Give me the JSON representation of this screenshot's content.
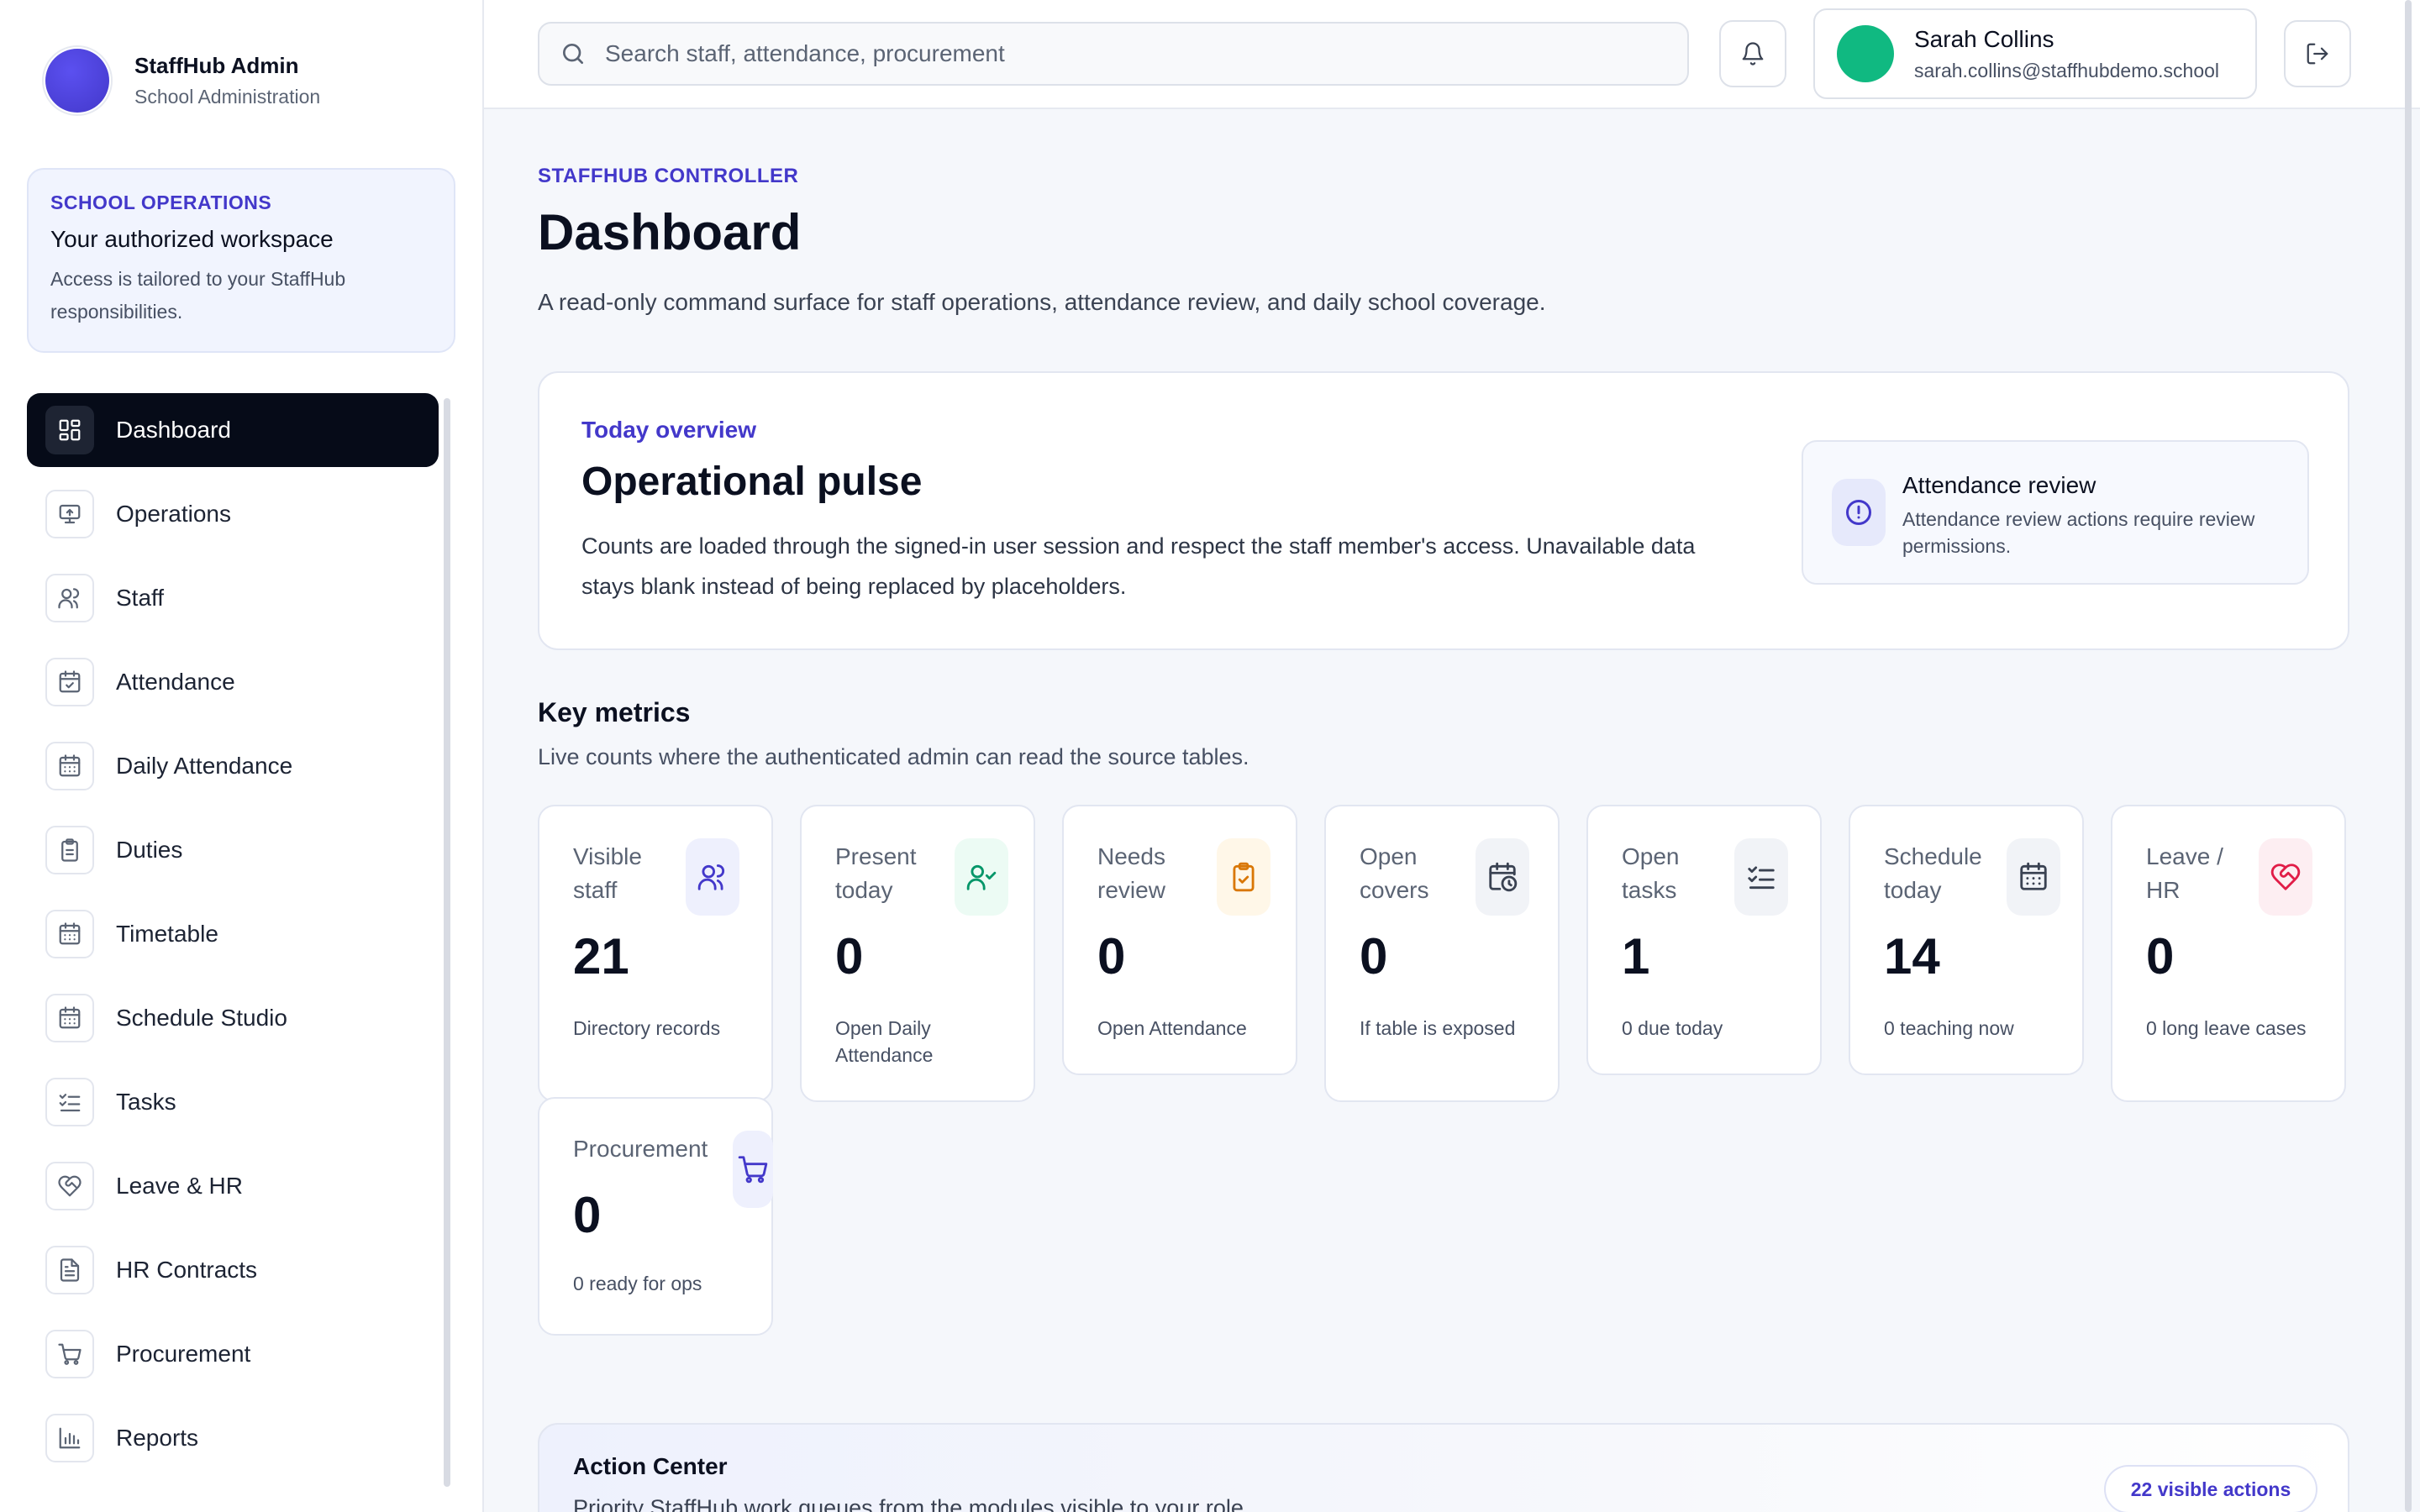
{
  "brand": {
    "title": "StaffHub Admin",
    "subtitle": "School Administration"
  },
  "workspace": {
    "eyebrow": "SCHOOL OPERATIONS",
    "title": "Your authorized workspace",
    "description": "Access is tailored to your StaffHub responsibilities."
  },
  "sidebar": {
    "items": [
      {
        "label": "Dashboard",
        "icon": "dashboard-icon",
        "active": true
      },
      {
        "label": "Operations",
        "icon": "monitor-icon"
      },
      {
        "label": "Staff",
        "icon": "users-icon"
      },
      {
        "label": "Attendance",
        "icon": "calendar-check-icon"
      },
      {
        "label": "Daily Attendance",
        "icon": "calendar-icon"
      },
      {
        "label": "Duties",
        "icon": "clipboard-icon"
      },
      {
        "label": "Timetable",
        "icon": "calendar-icon"
      },
      {
        "label": "Schedule Studio",
        "icon": "calendar-icon"
      },
      {
        "label": "Tasks",
        "icon": "checklist-icon"
      },
      {
        "label": "Leave & HR",
        "icon": "heart-handshake-icon"
      },
      {
        "label": "HR Contracts",
        "icon": "file-text-icon"
      },
      {
        "label": "Procurement",
        "icon": "cart-icon"
      },
      {
        "label": "Reports",
        "icon": "bar-chart-icon"
      }
    ]
  },
  "topbar": {
    "search_placeholder": "Search staff, attendance, procurement",
    "user": {
      "name": "Sarah Collins",
      "email": "sarah.collins@staffhubdemo.school",
      "avatar_color": "#10b981"
    }
  },
  "header": {
    "eyebrow": "STAFFHUB CONTROLLER",
    "title": "Dashboard",
    "description": "A read-only command surface for staff operations, attendance review, and daily school coverage."
  },
  "overview": {
    "eyebrow": "Today overview",
    "title": "Operational pulse",
    "description": "Counts are loaded through the signed-in user session and respect the staff member's access. Unavailable data stays blank instead of being replaced by placeholders.",
    "review": {
      "title": "Attendance review",
      "description": "Attendance review actions require review permissions."
    }
  },
  "key_metrics": {
    "title": "Key metrics",
    "subtitle": "Live counts where the authenticated admin can read the source tables.",
    "cards": [
      {
        "label": "Visible staff",
        "value": "21",
        "sub": "Directory records",
        "icon": "users-icon",
        "accent": "#4338ca",
        "tint": "#eef0fd"
      },
      {
        "label": "Present today",
        "value": "0",
        "sub": "Open Daily Attendance",
        "icon": "user-check-icon",
        "accent": "#059669",
        "tint": "#ecfbf4"
      },
      {
        "label": "Needs review",
        "value": "0",
        "sub": "Open Attendance",
        "icon": "clipboard-check-icon",
        "accent": "#d97706",
        "tint": "#fff7e8"
      },
      {
        "label": "Open covers",
        "value": "0",
        "sub": "If table is exposed",
        "icon": "calendar-clock-icon",
        "accent": "#3a4252",
        "tint": "#f1f3f7"
      },
      {
        "label": "Open tasks",
        "value": "1",
        "sub": "0 due today",
        "icon": "checklist-icon",
        "accent": "#3a4252",
        "tint": "#f1f3f7"
      },
      {
        "label": "Schedule today",
        "value": "14",
        "sub": "0 teaching now",
        "icon": "calendar-icon",
        "accent": "#3a4252",
        "tint": "#f1f3f7"
      },
      {
        "label": "Leave / HR",
        "value": "0",
        "sub": "0 long leave cases",
        "icon": "heart-handshake-icon",
        "accent": "#e11d48",
        "tint": "#fdeef2"
      },
      {
        "label": "Procurement",
        "value": "0",
        "sub": "0 ready for ops",
        "icon": "cart-icon",
        "accent": "#4338ca",
        "tint": "#eef0fd"
      }
    ]
  },
  "action_center": {
    "title": "Action Center",
    "subtitle": "Priority StaffHub work queues from the modules visible to your role.",
    "badge": "22 visible actions"
  }
}
